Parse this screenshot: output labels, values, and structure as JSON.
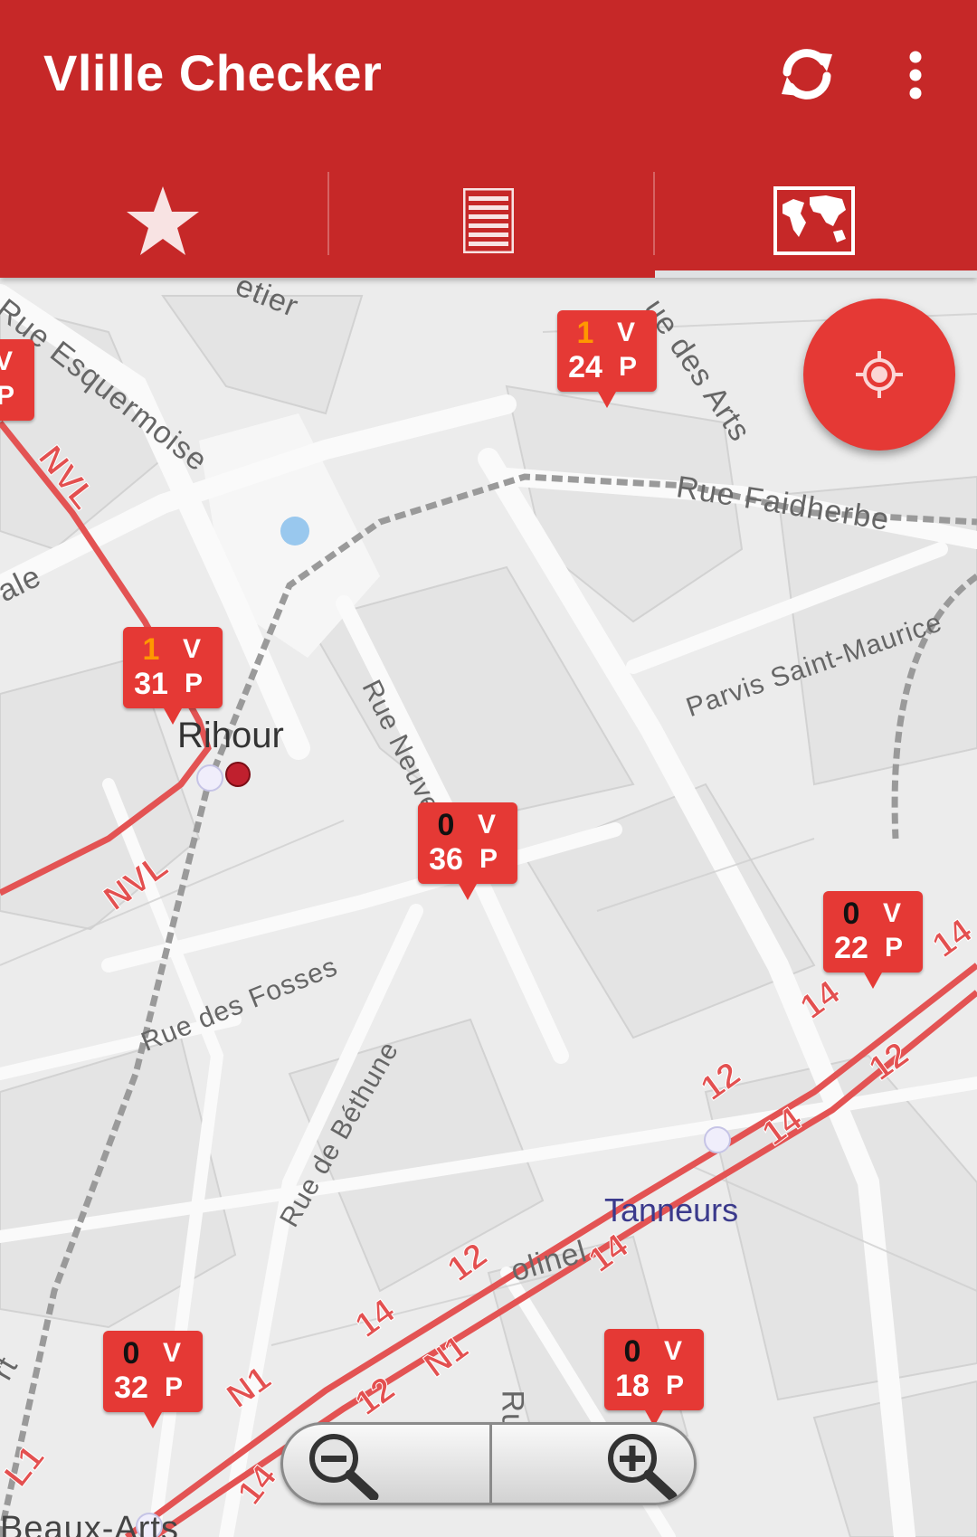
{
  "app": {
    "title": "Vlille Checker",
    "actions": {
      "refresh_icon": "refresh-icon",
      "overflow_icon": "more-vert-icon"
    },
    "accent_color": "#c62828"
  },
  "tabs": [
    {
      "name": "favorites",
      "icon": "star-icon"
    },
    {
      "name": "list",
      "icon": "list-icon"
    },
    {
      "name": "map",
      "icon": "map-icon",
      "selected": true
    }
  ],
  "map": {
    "streets": {
      "s1": "etier",
      "s2": "Rue Esquermoise",
      "s3": "ue des Arts",
      "s4": "Rue Faidherbe",
      "s5": "ale",
      "s6": "Parvis Saint-Maurice",
      "s7": "Rue Neuve",
      "s8": "Rue des Fosses",
      "s9": "Rue de Béthune",
      "s10": "olinel",
      "s11": "Rue",
      "s12": "rt",
      "s13": "Beaux-Arts"
    },
    "lines": {
      "l1": "NVL",
      "l2": "NVL",
      "l3": "14",
      "l4": "14",
      "l5": "12",
      "l6": "12",
      "l7": "14",
      "l8": "14",
      "l9": "12",
      "l10": "14",
      "l11": "12",
      "l12": "N1",
      "l13": "N1",
      "l14": "L1",
      "l15": "14",
      "l16": "12"
    },
    "stops": {
      "rihour": "Rihour",
      "tanneurs": "Tanneurs"
    },
    "markers": [
      {
        "bikes": "",
        "places": "",
        "v": "V",
        "p": "P",
        "bikes_color": "black"
      },
      {
        "bikes": "1",
        "places": "24",
        "v": "V",
        "p": "P",
        "bikes_color": "orange"
      },
      {
        "bikes": "1",
        "places": "31",
        "v": "V",
        "p": "P",
        "bikes_color": "orange"
      },
      {
        "bikes": "0",
        "places": "36",
        "v": "V",
        "p": "P",
        "bikes_color": "black"
      },
      {
        "bikes": "0",
        "places": "22",
        "v": "V",
        "p": "P",
        "bikes_color": "black"
      },
      {
        "bikes": "0",
        "places": "32",
        "v": "V",
        "p": "P",
        "bikes_color": "black"
      },
      {
        "bikes": "0",
        "places": "18",
        "v": "V",
        "p": "P",
        "bikes_color": "black"
      }
    ],
    "locate_icon": "my-location-icon",
    "zoom": {
      "out_icon": "zoom-out-icon",
      "in_icon": "zoom-in-icon"
    }
  }
}
